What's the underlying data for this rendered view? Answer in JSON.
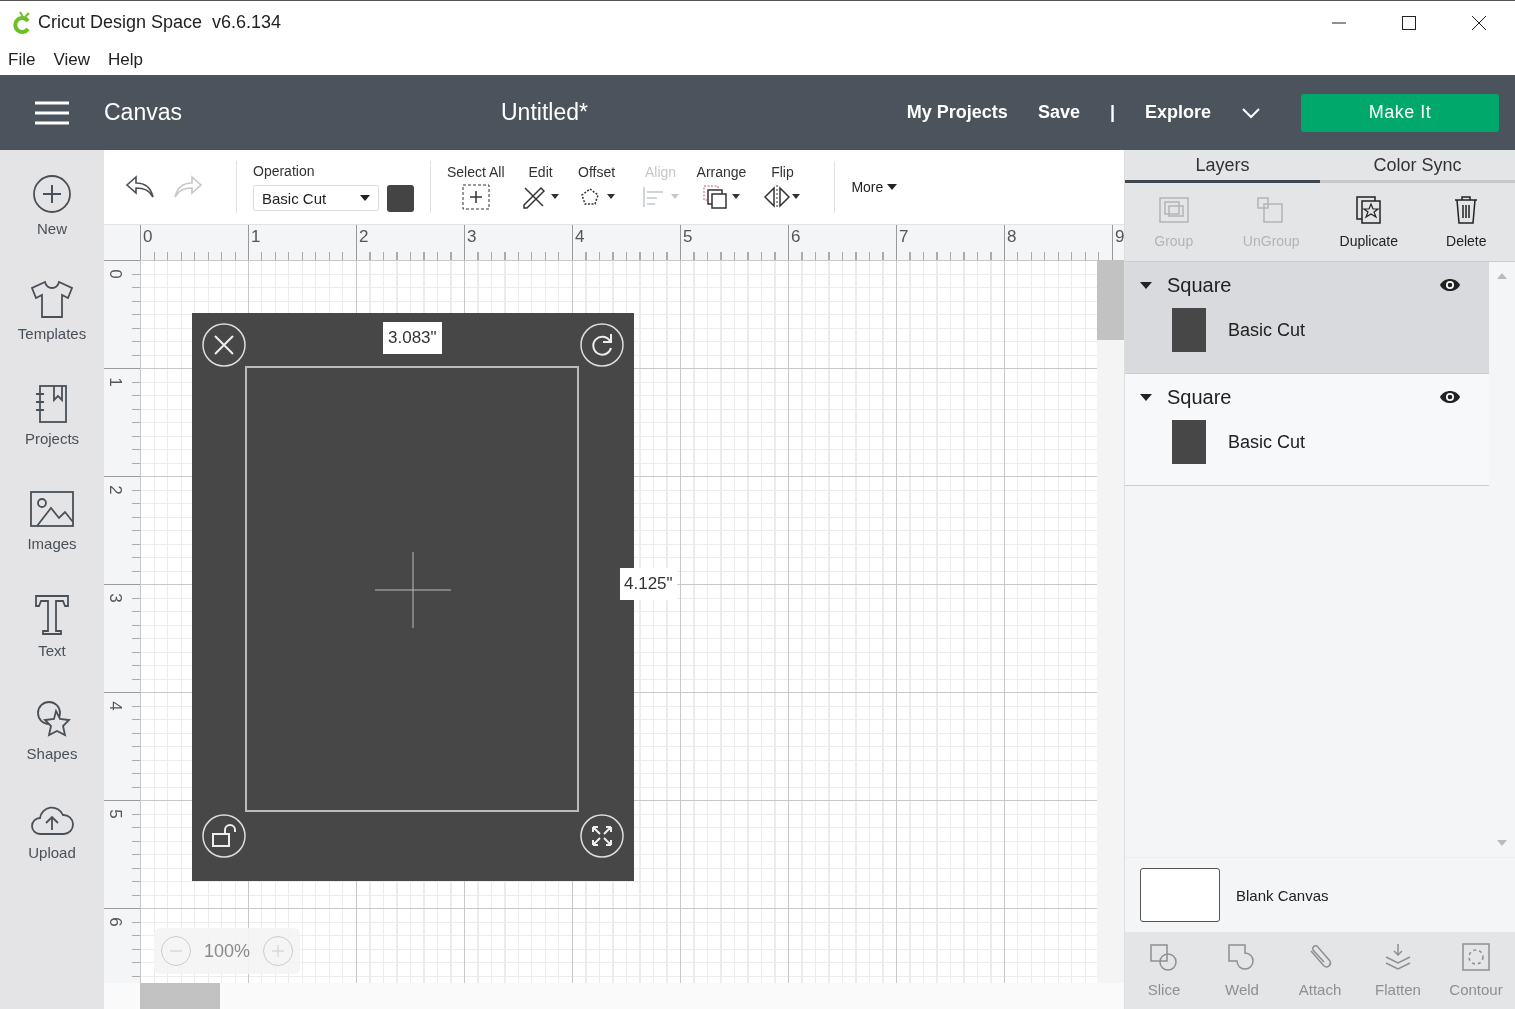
{
  "window": {
    "title": "Cricut Design Space  v6.6.134"
  },
  "menu": [
    "File",
    "View",
    "Help"
  ],
  "header": {
    "page": "Canvas",
    "project": "Untitled*",
    "links": [
      "My Projects",
      "Save",
      "|",
      "Explore"
    ],
    "make_button": "Make It"
  },
  "sidebar": {
    "items": [
      {
        "label": "New"
      },
      {
        "label": "Templates"
      },
      {
        "label": "Projects"
      },
      {
        "label": "Images"
      },
      {
        "label": "Text"
      },
      {
        "label": "Shapes"
      },
      {
        "label": "Upload"
      }
    ]
  },
  "toolbar": {
    "history": [
      {
        "disabled": false
      },
      {
        "disabled": true
      }
    ],
    "operation": {
      "label": "Operation",
      "value": "Basic Cut"
    },
    "tools": [
      {
        "label": "Select All",
        "disabled": false
      },
      {
        "label": "Edit",
        "disabled": false
      },
      {
        "label": "Offset",
        "disabled": false
      },
      {
        "label": "Align",
        "disabled": true
      },
      {
        "label": "Arrange",
        "disabled": false
      },
      {
        "label": "Flip",
        "disabled": false
      }
    ],
    "more": "More"
  },
  "ruler": {
    "x_labels": [
      "0",
      "1",
      "2",
      "3",
      "4",
      "5",
      "6",
      "7",
      "8",
      "9"
    ],
    "y_labels": [
      "0",
      "1",
      "2",
      "3",
      "4",
      "5",
      "6"
    ]
  },
  "canvas": {
    "width_label": "3.083\"",
    "height_label": "4.125\"",
    "zoom": "100%"
  },
  "panel": {
    "tabs": [
      {
        "label": "Layers",
        "selected": true
      },
      {
        "label": "Color Sync",
        "selected": false
      }
    ],
    "actions": [
      {
        "label": "Group",
        "disabled": true
      },
      {
        "label": "UnGroup",
        "disabled": true
      },
      {
        "label": "Duplicate",
        "disabled": false
      },
      {
        "label": "Delete",
        "disabled": false
      }
    ],
    "layers": [
      {
        "name": "Square",
        "expanded": true,
        "selected": true,
        "visible": true,
        "operation": "Basic Cut"
      },
      {
        "name": "Square",
        "expanded": true,
        "selected": false,
        "visible": true,
        "operation": "Basic Cut"
      }
    ],
    "blank_canvas": "Blank Canvas",
    "bottom_actions": [
      {
        "label": "Slice",
        "disabled": true
      },
      {
        "label": "Weld",
        "disabled": true
      },
      {
        "label": "Attach",
        "disabled": true
      },
      {
        "label": "Flatten",
        "disabled": true
      },
      {
        "label": "Contour",
        "disabled": true
      }
    ]
  }
}
